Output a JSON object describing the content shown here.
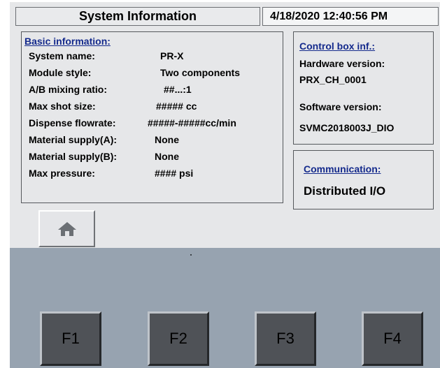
{
  "header": {
    "title": "System Information",
    "datetime": "4/18/2020 12:40:56 PM"
  },
  "basic": {
    "heading": "Basic information:",
    "rows": [
      {
        "label": "System name:",
        "value": "PR-X"
      },
      {
        "label": "Module style:",
        "value": "Two components"
      },
      {
        "label": "A/B mixing ratio:",
        "value": "##...:1"
      },
      {
        "label": "Max shot size:",
        "value": "##### cc"
      },
      {
        "label": "Dispense flowrate:",
        "value": "#####-#####cc/min"
      },
      {
        "label": "Material supply(A):",
        "value": "None"
      },
      {
        "label": "Material supply(B):",
        "value": "None"
      },
      {
        "label": "Max pressure:",
        "value": "#### psi"
      }
    ]
  },
  "control_box": {
    "heading": "Control box inf.:",
    "hardware_label": "Hardware version:",
    "hardware_value": "PRX_CH_0001",
    "software_label": "Software version:",
    "software_value": "SVMC2018003J_DIO"
  },
  "communication": {
    "heading": "Communication:",
    "value": "Distributed I/O"
  },
  "home_button": {
    "icon": "home-icon"
  },
  "function_keys": [
    "F1",
    "F2",
    "F3",
    "F4"
  ],
  "colors": {
    "heading_blue": "#142a8c",
    "panel_gray": "#e6e7e9",
    "bottom_panel": "#97a3b0",
    "fkey_face": "#4f5257"
  }
}
